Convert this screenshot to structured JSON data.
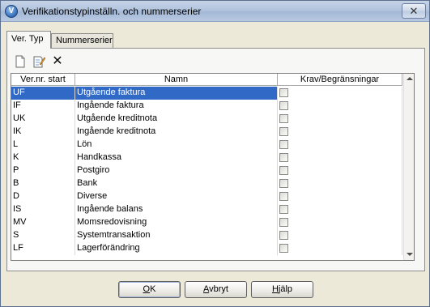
{
  "window": {
    "title": "Verifikationstypinställn. och nummerserier",
    "app_icon_letter": "V",
    "close_label": "✕"
  },
  "tabs": [
    {
      "label": "Ver. Typ",
      "active": true
    },
    {
      "label": "Nummerserier",
      "active": false
    }
  ],
  "toolbar": {
    "icons": [
      "new-document-icon",
      "edit-document-icon",
      "delete-icon"
    ],
    "delete_glyph": "✕"
  },
  "grid": {
    "columns": [
      "Ver.nr. start",
      "Namn",
      "Krav/Begränsningar"
    ],
    "rows": [
      {
        "code": "UF",
        "name": "Utgående faktura",
        "checked": false,
        "selected": true
      },
      {
        "code": "IF",
        "name": "Ingående faktura",
        "checked": false,
        "selected": false
      },
      {
        "code": "UK",
        "name": "Utgående kreditnota",
        "checked": false,
        "selected": false
      },
      {
        "code": "IK",
        "name": "Ingående kreditnota",
        "checked": false,
        "selected": false
      },
      {
        "code": "L",
        "name": "Lön",
        "checked": false,
        "selected": false
      },
      {
        "code": "K",
        "name": "Handkassa",
        "checked": false,
        "selected": false
      },
      {
        "code": "P",
        "name": "Postgiro",
        "checked": false,
        "selected": false
      },
      {
        "code": "B",
        "name": "Bank",
        "checked": false,
        "selected": false
      },
      {
        "code": "D",
        "name": "Diverse",
        "checked": false,
        "selected": false
      },
      {
        "code": "IS",
        "name": "Ingående balans",
        "checked": false,
        "selected": false
      },
      {
        "code": "MV",
        "name": "Momsredovisning",
        "checked": false,
        "selected": false
      },
      {
        "code": "S",
        "name": "Systemtransaktion",
        "checked": false,
        "selected": false
      },
      {
        "code": "LF",
        "name": "Lagerförändring",
        "checked": false,
        "selected": false
      }
    ]
  },
  "buttons": {
    "ok": {
      "underline": "O",
      "rest": "K"
    },
    "cancel": {
      "underline": "A",
      "rest": "vbryt"
    },
    "help": {
      "underline": "H",
      "rest": "jälp"
    }
  },
  "colors": {
    "selection": "#3169c6",
    "dialog_bg": "#ece9d8"
  }
}
